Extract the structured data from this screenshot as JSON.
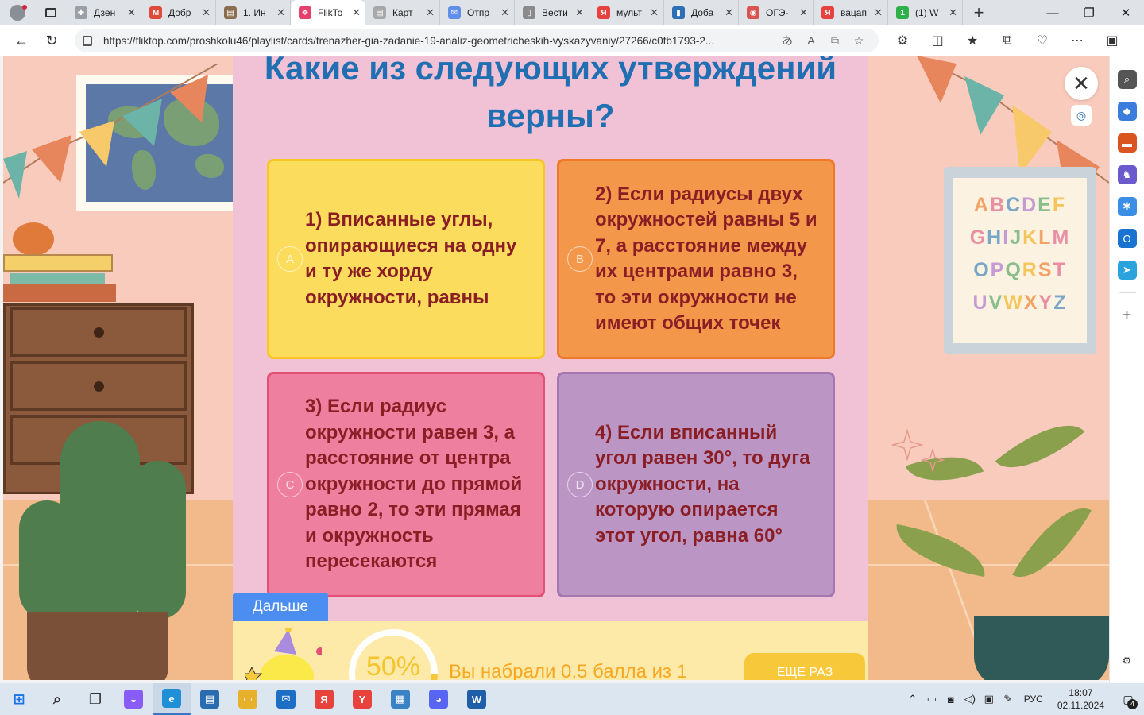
{
  "browser": {
    "tabs": [
      {
        "title": "Дзен",
        "favicon": "dzen-icon",
        "color": "#9aa0a6",
        "glyph": "✚",
        "active": false
      },
      {
        "title": "Добр",
        "favicon": "gmail-icon",
        "color": "#e04a3b",
        "glyph": "M",
        "active": false
      },
      {
        "title": "1. Ин",
        "favicon": "doc-icon",
        "color": "#8b6d4f",
        "glyph": "▤",
        "active": false
      },
      {
        "title": "FlikTo",
        "favicon": "fliktop-icon",
        "color": "#e8406c",
        "glyph": "❖",
        "active": true
      },
      {
        "title": "Карт",
        "favicon": "doc-icon",
        "color": "#a8a8a8",
        "glyph": "▤",
        "active": false
      },
      {
        "title": "Отпр",
        "favicon": "mail-icon",
        "color": "#5f8fe8",
        "glyph": "✉",
        "active": false
      },
      {
        "title": "Вести",
        "favicon": "page-icon",
        "color": "#8a8a8a",
        "glyph": "▯",
        "active": false
      },
      {
        "title": "мульт",
        "favicon": "yandex-icon",
        "color": "#e8423c",
        "glyph": "Я",
        "active": false
      },
      {
        "title": "Доба",
        "favicon": "book-icon",
        "color": "#2c6fb5",
        "glyph": "▮",
        "active": false
      },
      {
        "title": "ОГЭ-",
        "favicon": "oge-icon",
        "color": "#d9534f",
        "glyph": "◉",
        "active": false
      },
      {
        "title": "вацап",
        "favicon": "yandex-icon",
        "color": "#e8423c",
        "glyph": "Я",
        "active": false
      },
      {
        "title": "(1) W",
        "favicon": "whatsapp-icon",
        "color": "#2fb14a",
        "glyph": "1",
        "active": false
      }
    ],
    "url": "https://fliktop.com/proshkolu46/playlist/cards/trenazher-gia-zadanie-19-analiz-geometricheskih-vyskazyvaniy/27266/c0fb1793-2...",
    "sidebar_icons": [
      {
        "name": "search-icon",
        "color": "#555",
        "glyph": "⌕"
      },
      {
        "name": "tag-icon",
        "color": "#3b7ddd",
        "glyph": "◆"
      },
      {
        "name": "toolbox-icon",
        "color": "#d9541e",
        "glyph": "▬"
      },
      {
        "name": "chess-icon",
        "color": "#6a5acd",
        "glyph": "♞"
      },
      {
        "name": "copilot-icon",
        "color": "#3a8ee6",
        "glyph": "✱"
      },
      {
        "name": "outlook-icon",
        "color": "#1874d0",
        "glyph": "O"
      },
      {
        "name": "telegram-icon",
        "color": "#2aa3dd",
        "glyph": "➤"
      }
    ]
  },
  "quiz": {
    "question": "Какие из следующих утверждений верны?",
    "answers": [
      {
        "letter": "A",
        "text": "1) Вписанные углы, опирающиеся на одну и ту же хорду окружности, равны"
      },
      {
        "letter": "B",
        "text": "2) Если радиусы двух окружностей равны 5 и 7, а расстояние между их центрами равно 3, то эти окружности не имеют общих точек"
      },
      {
        "letter": "C",
        "text": "3) Если радиус окружности равен 3, а расстояние от центра окружности до прямой равно 2, то эти прямая и окружность пересекаются"
      },
      {
        "letter": "D",
        "text": "4) Если вписанный угол равен 30°, то дуга окружности, на которую опирается этот угол, равна 60°"
      }
    ],
    "next_label": "Дальше",
    "result": {
      "percent_label": "50%",
      "percent_value": 0.5,
      "score_text": "Вы набрали 0.5 балла из 1",
      "again_label": "ЕЩЕ РАЗ"
    }
  },
  "room": {
    "poster_letters": [
      "A B C D E F",
      "G H I J K L M",
      "O P Q R S T",
      "U V W X Y Z"
    ]
  },
  "taskbar": {
    "apps": [
      {
        "name": "start-icon",
        "color": "#1a73e8",
        "glyph": "⊞"
      },
      {
        "name": "search-icon",
        "color": "#333",
        "glyph": "⌕"
      },
      {
        "name": "task-view-icon",
        "color": "#333",
        "glyph": "❐"
      },
      {
        "name": "alice-icon",
        "color": "#8a5cf6",
        "glyph": "◒"
      },
      {
        "name": "edge-icon",
        "color": "#1f8fd6",
        "glyph": "e"
      },
      {
        "name": "dashboard-icon",
        "color": "#2b6cb0",
        "glyph": "▤"
      },
      {
        "name": "explorer-icon",
        "color": "#e8b12b",
        "glyph": "▭"
      },
      {
        "name": "mail-icon",
        "color": "#1c6fc4",
        "glyph": "✉"
      },
      {
        "name": "yandex-icon",
        "color": "#e8423c",
        "glyph": "Я"
      },
      {
        "name": "yandex-browser-icon",
        "color": "#e8423c",
        "glyph": "Y"
      },
      {
        "name": "store-icon",
        "color": "#3b82c4",
        "glyph": "▦"
      },
      {
        "name": "discord-icon",
        "color": "#5865f2",
        "glyph": "◕"
      },
      {
        "name": "word-icon",
        "color": "#1f5ea8",
        "glyph": "W"
      }
    ],
    "language": "РУС",
    "time": "18:07",
    "date": "02.11.2024",
    "notifications": "4"
  }
}
